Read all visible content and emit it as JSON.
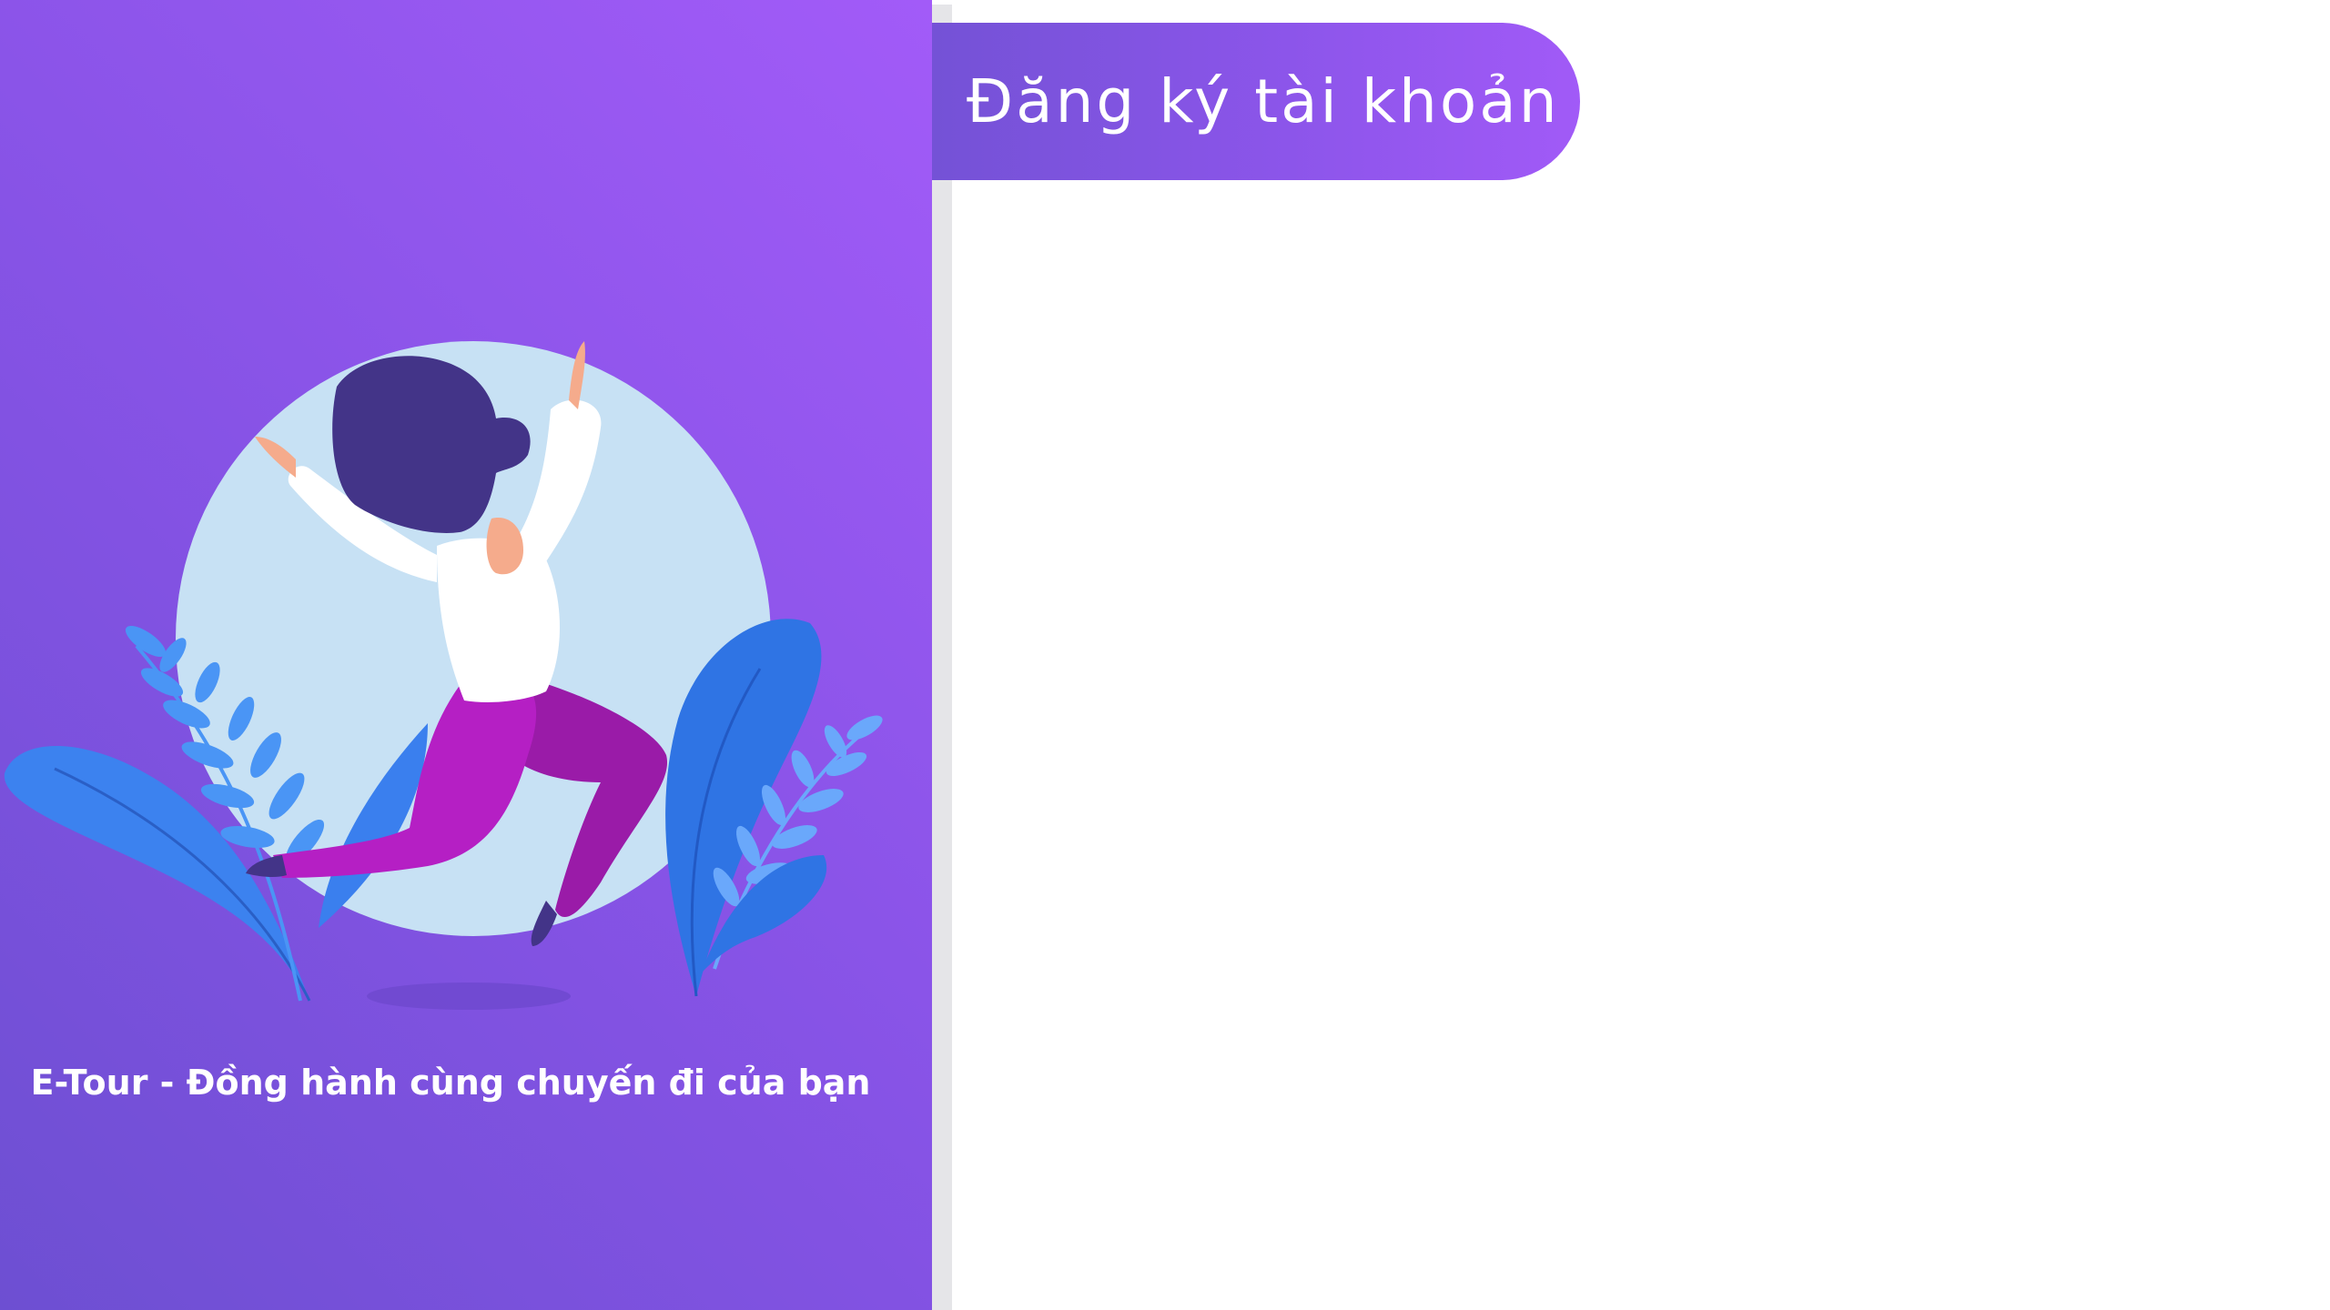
{
  "header": {
    "title": "Đăng ký tài khoản"
  },
  "hero": {
    "tagline": "E-Tour - Đồng hành cùng chuyến đi của bạn",
    "illustration": "woman-jumping-illustration"
  },
  "colors": {
    "gradient_start": "#6d4fd2",
    "gradient_end": "#a25bf8",
    "circle": "#c7e1f4",
    "leaf_dark": "#2f74e4",
    "leaf_light": "#4a95f5",
    "hair": "#433488",
    "pants": "#b51fc4",
    "shirt": "#ffffff",
    "skin": "#f5ab8c"
  }
}
